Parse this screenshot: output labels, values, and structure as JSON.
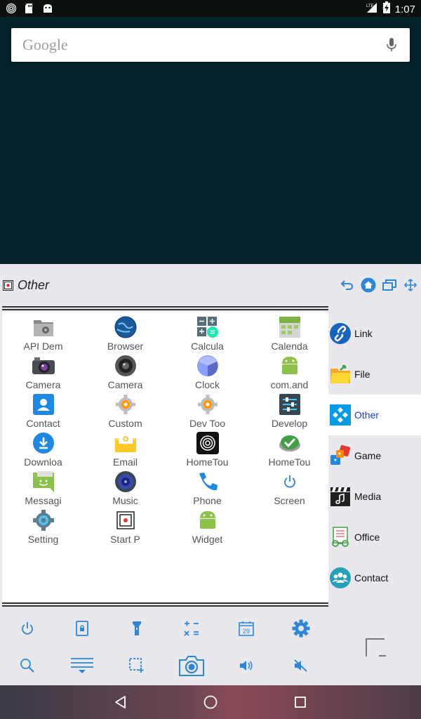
{
  "status_bar": {
    "time": "1:07",
    "network": "LTE",
    "icons_left": [
      "fingerprint-icon",
      "sd-card-icon",
      "android-icon"
    ]
  },
  "search": {
    "label": "Google",
    "mic_icon": "mic-icon"
  },
  "panel": {
    "title": "Other",
    "header_actions": [
      "undo-icon",
      "home-icon",
      "windows-icon",
      "move-icon"
    ],
    "apps": [
      {
        "label": "API Dem",
        "icon": "folder-gear-icon"
      },
      {
        "label": "Browser",
        "icon": "globe-icon"
      },
      {
        "label": "Calcula",
        "icon": "calculator-icon"
      },
      {
        "label": "Calenda",
        "icon": "calendar-icon"
      },
      {
        "label": "Camera",
        "icon": "camera-icon"
      },
      {
        "label": "Camera",
        "icon": "camera-lens-icon"
      },
      {
        "label": "Clock",
        "icon": "clock-icon"
      },
      {
        "label": "com.and",
        "icon": "android-icon"
      },
      {
        "label": "Contact",
        "icon": "contact-icon"
      },
      {
        "label": "Custom",
        "icon": "gear-icon"
      },
      {
        "label": "Dev Too",
        "icon": "gear-icon"
      },
      {
        "label": "Develop",
        "icon": "settings-sliders-icon"
      },
      {
        "label": "Downloa",
        "icon": "download-icon"
      },
      {
        "label": "Email",
        "icon": "email-icon"
      },
      {
        "label": "HomeTou",
        "icon": "fingerprint-icon"
      },
      {
        "label": "HomeTou",
        "icon": "check-badge-icon"
      },
      {
        "label": "Messagi",
        "icon": "message-icon"
      },
      {
        "label": "Music",
        "icon": "speaker-icon"
      },
      {
        "label": "Phone",
        "icon": "phone-icon"
      },
      {
        "label": "Screen",
        "icon": "power-icon"
      },
      {
        "label": "Setting",
        "icon": "settings-icon"
      },
      {
        "label": "Start P",
        "icon": "start-page-icon"
      },
      {
        "label": "Widget",
        "icon": "android-icon"
      }
    ],
    "categories": [
      {
        "label": "Link",
        "icon": "link-icon",
        "active": false
      },
      {
        "label": "File",
        "icon": "folder-icon",
        "active": false
      },
      {
        "label": "Other",
        "icon": "other-icon",
        "active": true
      },
      {
        "label": "Game",
        "icon": "game-icon",
        "active": false
      },
      {
        "label": "Media",
        "icon": "clapperboard-icon",
        "active": false
      },
      {
        "label": "Office",
        "icon": "office-icon",
        "active": false
      },
      {
        "label": "Contact",
        "icon": "people-icon",
        "active": false
      }
    ],
    "tools_row1": [
      "power-icon",
      "lock-icon",
      "flashlight-icon",
      "calculator-icon",
      "calendar-icon",
      "gear-icon"
    ],
    "tools_row2": [
      "search-icon",
      "menu-icon",
      "select-icon",
      "screenshot-camera-icon",
      "volume-icon",
      "mute-icon"
    ],
    "calendar_day": "29"
  },
  "nav": [
    "back-icon",
    "home-icon",
    "recents-icon"
  ],
  "colors": {
    "accent": "#2d86d8",
    "active_label": "#1e3bd6",
    "wallpaper": "#03212b"
  }
}
